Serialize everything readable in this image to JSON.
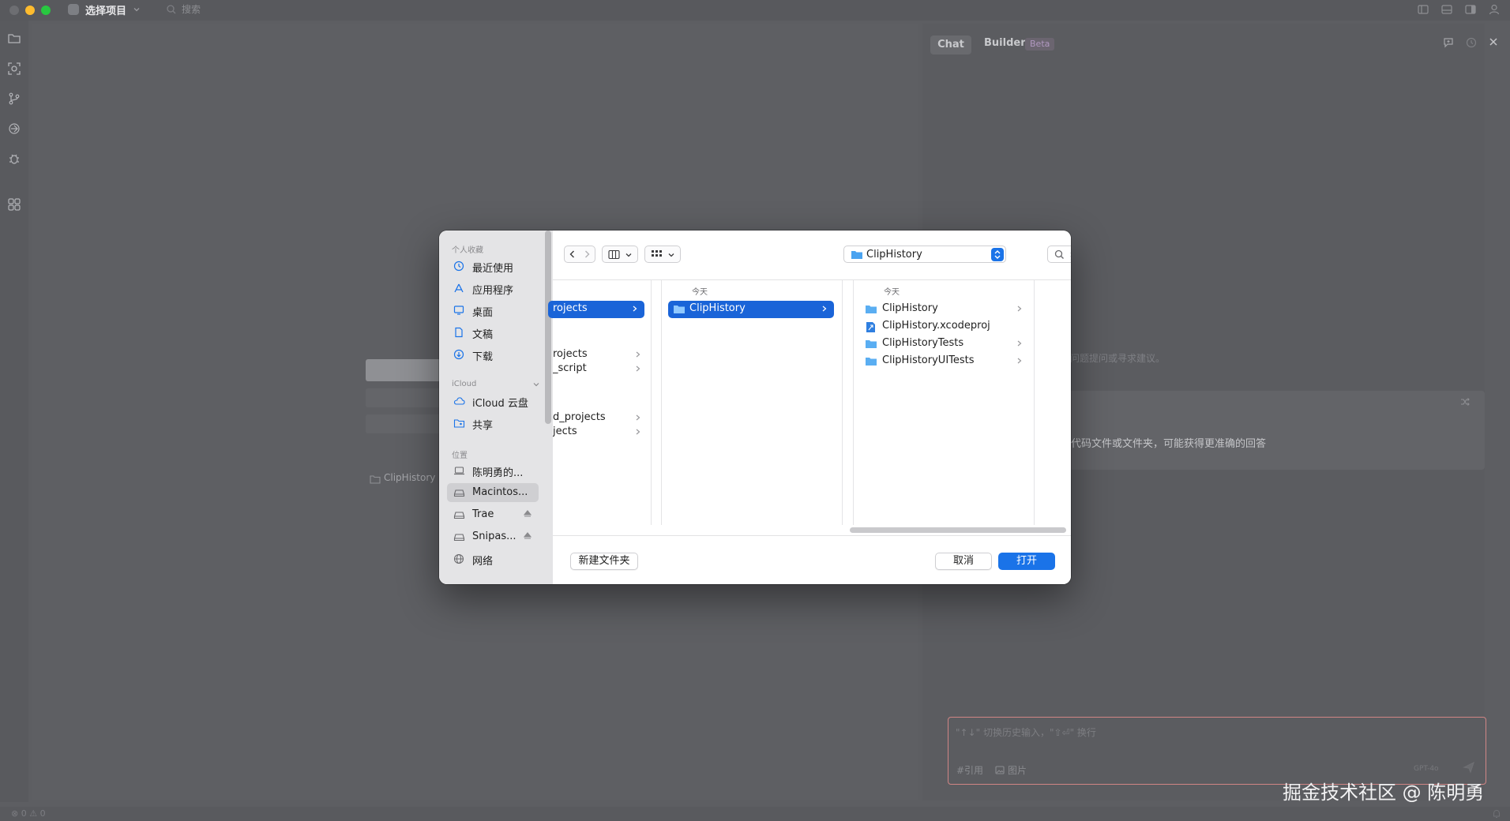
{
  "titlebar": {
    "title": "选择项目",
    "search_placeholder": "搜索"
  },
  "editor": {
    "recent_project": "ClipHistory"
  },
  "chat_panel": {
    "tab_chat": "Chat",
    "tab_builder": "Builder",
    "beta_badge": "Beta",
    "hint": "问题提问或寻求建议。",
    "context_hint": "代码文件或文件夹，可能获得更准确的回答",
    "input_placeholder": "\"↑↓\" 切换历史输入，\"⇧⏎\" 换行",
    "quote_label": "#引用",
    "image_label": "图片",
    "model_label": "GPT-4o"
  },
  "watermark": "掘金技术社区 @ 陈明勇",
  "statusbar": {
    "text": "⊗ 0 ⚠ 0"
  },
  "dialog": {
    "sidebar": {
      "favorites_header": "个人收藏",
      "favorites": [
        {
          "label": "最近使用",
          "icon": "clock-icon"
        },
        {
          "label": "应用程序",
          "icon": "apps-icon"
        },
        {
          "label": "桌面",
          "icon": "desktop-icon"
        },
        {
          "label": "文稿",
          "icon": "document-icon"
        },
        {
          "label": "下载",
          "icon": "download-icon"
        }
      ],
      "icloud_header": "iCloud",
      "icloud": [
        {
          "label": "iCloud 云盘",
          "icon": "cloud-icon"
        },
        {
          "label": "共享",
          "icon": "shared-folder-icon"
        }
      ],
      "locations_header": "位置",
      "locations": [
        {
          "label": "陈明勇的...",
          "icon": "laptop-icon"
        },
        {
          "label": "Macintos...",
          "icon": "disk-icon",
          "selected": true
        },
        {
          "label": "Trae",
          "icon": "disk-icon",
          "eject": true
        },
        {
          "label": "Snipas...",
          "icon": "disk-icon",
          "eject": true
        },
        {
          "label": "网络",
          "icon": "globe-icon"
        }
      ]
    },
    "toolbar": {
      "path": "ClipHistory",
      "search_placeholder": "搜索"
    },
    "columns": {
      "col1": [
        "rojects",
        "rojects",
        "_script",
        "d_projects",
        "jects"
      ],
      "col2_header": "今天",
      "col2": [
        "ClipHistory"
      ],
      "col3_header": "今天",
      "col3": [
        "ClipHistory",
        "ClipHistory.xcodeproj",
        "ClipHistoryTests",
        "ClipHistoryUITests"
      ]
    },
    "footer": {
      "new_folder": "新建文件夹",
      "cancel": "取消",
      "open": "打开"
    }
  },
  "colors": {
    "accent": "#1a73e8",
    "selection": "#1a64d8",
    "close": "#ff5f57",
    "minimize": "#febc2e",
    "zoom": "#28c840"
  }
}
